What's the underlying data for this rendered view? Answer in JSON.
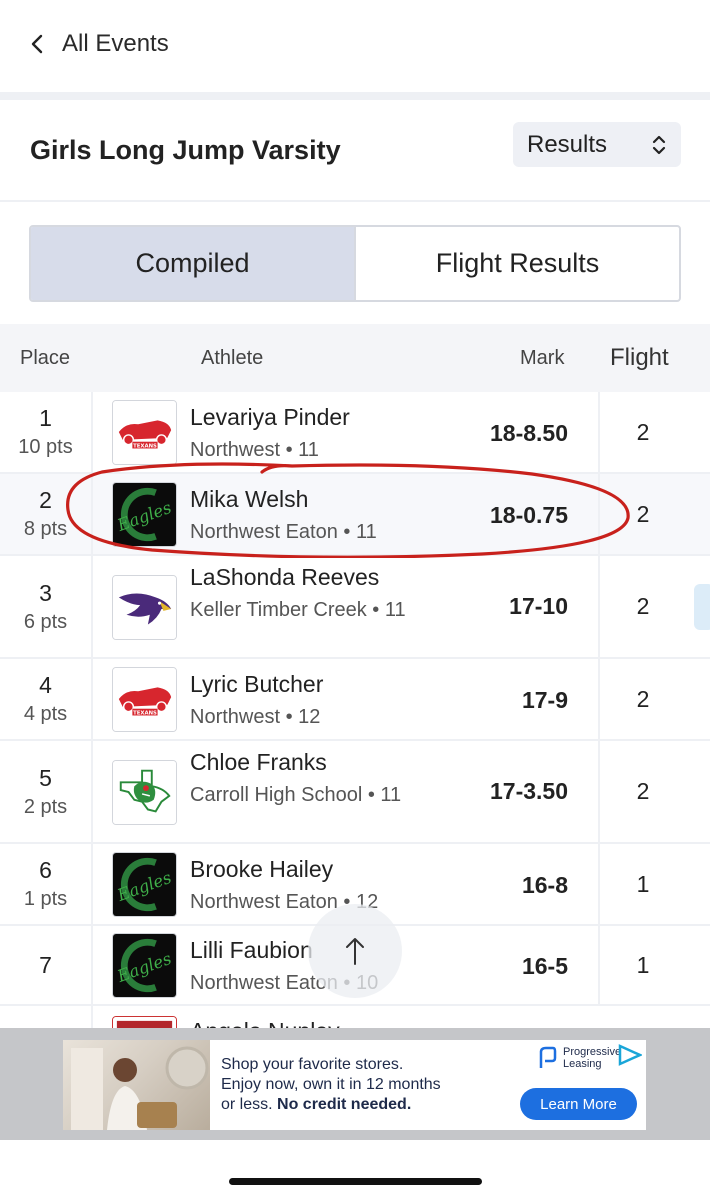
{
  "nav": {
    "back_label": "All Events"
  },
  "event": {
    "title": "Girls Long Jump Varsity",
    "view_select": "Results"
  },
  "toggle": {
    "compiled": "Compiled",
    "flight_results": "Flight Results",
    "active": "compiled"
  },
  "table": {
    "headers": {
      "place": "Place",
      "athlete": "Athlete",
      "mark": "Mark",
      "flight": "Flight"
    },
    "rows": [
      {
        "place": "1",
        "pts": "10 pts",
        "name": "Levariya Pinder",
        "school": "Northwest • 11",
        "mark": "18-8.50",
        "flight": "2",
        "logo": "texans-logo"
      },
      {
        "place": "2",
        "pts": "8 pts",
        "name": "Mika Welsh",
        "school": "Northwest Eaton • 11",
        "mark": "18-0.75",
        "flight": "2",
        "logo": "eagles-logo"
      },
      {
        "place": "3",
        "pts": "6 pts",
        "name": "LaShonda Reeves",
        "school": "Keller Timber Creek • 11",
        "mark": "17-10",
        "flight": "2",
        "logo": "falcon-logo"
      },
      {
        "place": "4",
        "pts": "4 pts",
        "name": "Lyric Butcher",
        "school": "Northwest • 12",
        "mark": "17-9",
        "flight": "2",
        "logo": "texans-logo"
      },
      {
        "place": "5",
        "pts": "2 pts",
        "name": "Chloe Franks",
        "school": "Carroll High School • 11",
        "mark": "17-3.50",
        "flight": "2",
        "logo": "dragon-texas-logo"
      },
      {
        "place": "6",
        "pts": "1 pts",
        "name": "Brooke Hailey",
        "school": "Northwest Eaton • 12",
        "mark": "16-8",
        "flight": "1",
        "logo": "eagles-logo"
      },
      {
        "place": "7",
        "pts": "",
        "name": "Lilli Faubion",
        "school": "Northwest Eaton • 10",
        "mark": "16-5",
        "flight": "1",
        "logo": "eagles-logo"
      },
      {
        "place": "",
        "pts": "",
        "name": "Angela Nunley",
        "school": "",
        "mark": "",
        "flight": "",
        "logo": "partial-logo"
      }
    ]
  },
  "ad": {
    "line1": "Shop your favorite stores.",
    "line2": "Enjoy now, own it in 12 months",
    "line3_pre": "or less. ",
    "line3_bold": "No credit needed.",
    "brand_line1": "Progressive",
    "brand_line2": "Leasing",
    "cta": "Learn More"
  },
  "colors": {
    "accent": "#1d6fe0",
    "toggle_active": "#d7dcea",
    "annotation": "#c8211c",
    "eagles_green": "#3fae49",
    "texans_red": "#d7262e"
  }
}
